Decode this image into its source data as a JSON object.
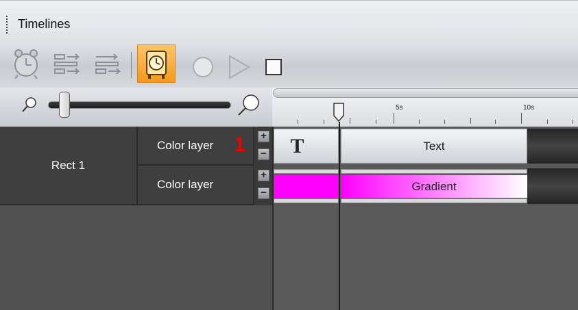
{
  "window": {
    "title": "Timelines"
  },
  "toolbar": {
    "buttons": [
      {
        "name": "alarm-clock-icon",
        "state": "disabled"
      },
      {
        "name": "align-left-icon",
        "state": "disabled"
      },
      {
        "name": "align-right-icon",
        "state": "disabled"
      },
      {
        "name": "autokey-clock-icon",
        "state": "active"
      },
      {
        "name": "record-icon",
        "state": "disabled"
      },
      {
        "name": "play-icon",
        "state": "disabled"
      },
      {
        "name": "stop-icon",
        "state": "enabled"
      }
    ]
  },
  "ruler": {
    "labels": [
      "5s",
      "10s"
    ]
  },
  "layers": {
    "object_name": "Rect 1",
    "rows": [
      {
        "label": "Color layer",
        "badge": "1",
        "clip_left_icon": "T",
        "clip_label": "Text"
      },
      {
        "label": "Color layer",
        "clip_label": "Gradient"
      }
    ]
  },
  "colors": {
    "accent": "#f39a1c",
    "gradient_start": "#ff00ff",
    "gradient_end": "#ffffff",
    "badge": "#e00000"
  }
}
